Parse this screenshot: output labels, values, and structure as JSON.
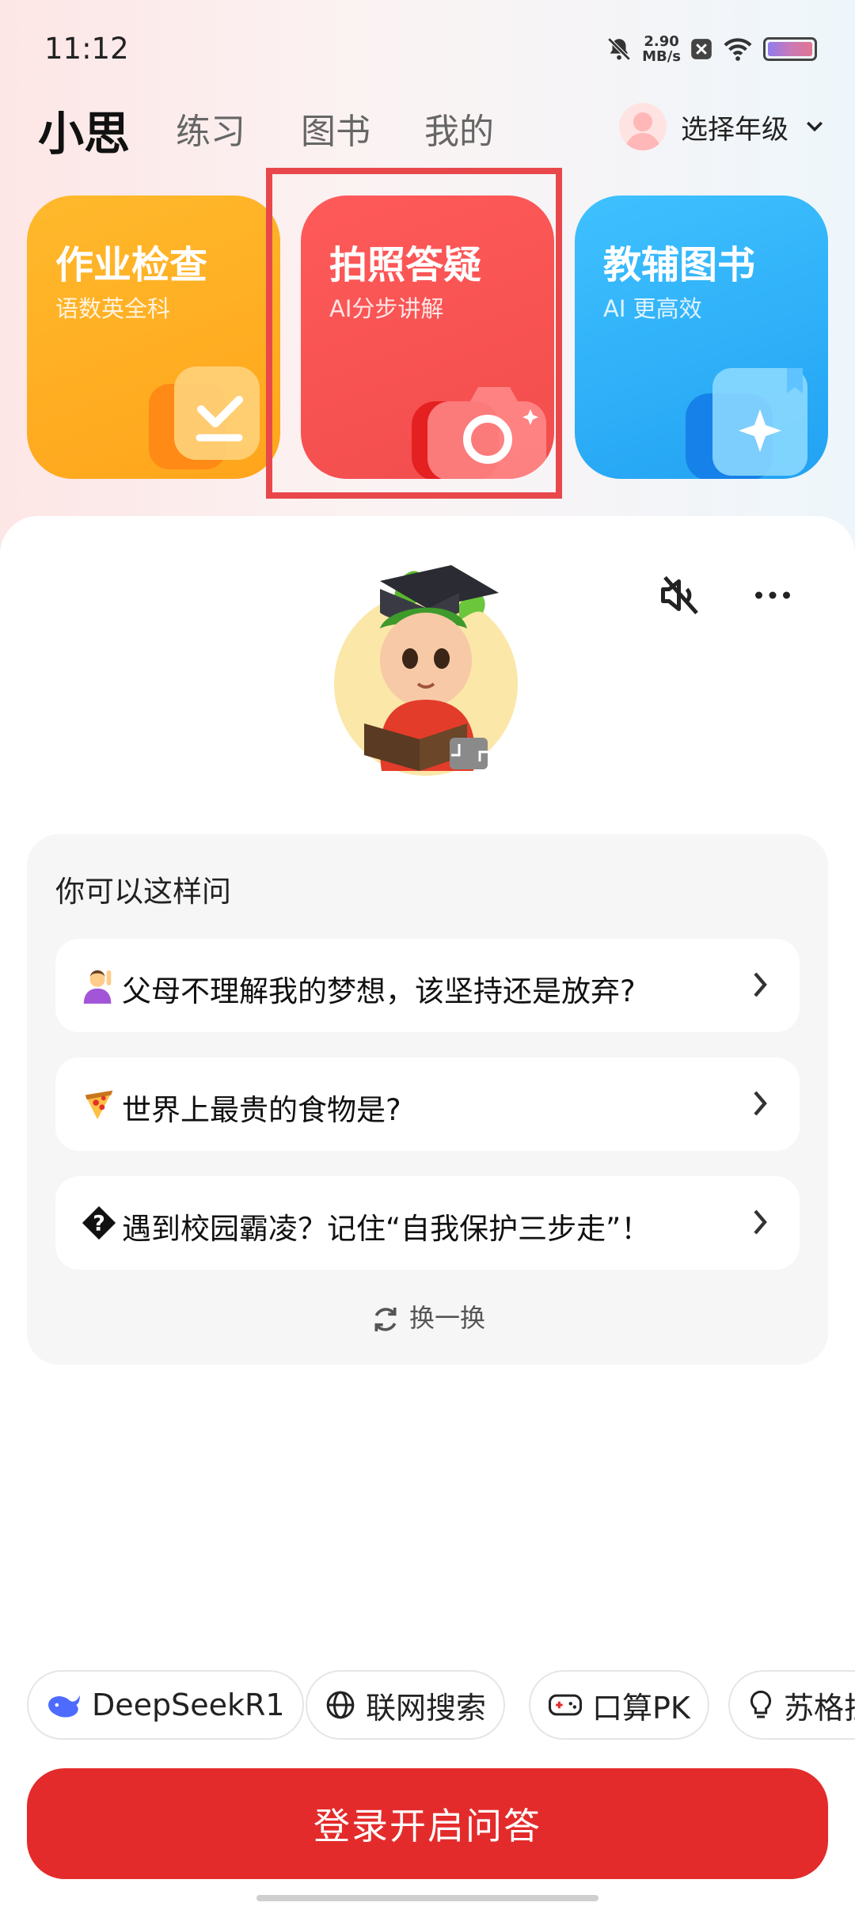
{
  "status_bar": {
    "time": "11:12",
    "speed_value": "2.90",
    "speed_unit": "MB/s"
  },
  "header": {
    "tabs": [
      {
        "label": "小思"
      },
      {
        "label": "练习"
      },
      {
        "label": "图书"
      },
      {
        "label": "我的"
      }
    ],
    "grade_label": "选择年级"
  },
  "cards": [
    {
      "title": "作业检查",
      "subtitle": "语数英全科",
      "color": "#ffb22a"
    },
    {
      "title": "拍照答疑",
      "subtitle": "AI分步讲解",
      "color": "#f65252"
    },
    {
      "title": "教辅图书",
      "subtitle": "AI 更高效",
      "color": "#2cb0f8"
    }
  ],
  "suggestions": {
    "title": "你可以这样问",
    "items": [
      {
        "icon": "person-raising-hand-emoji",
        "text": "父母不理解我的梦想，该坚持还是放弃?"
      },
      {
        "icon": "pizza-emoji",
        "text": "世界上最贵的食物是?"
      },
      {
        "icon": "unknown-glyph-icon",
        "text": "遇到校园霸凌？记住“自我保护三步走”！"
      }
    ],
    "refresh_label": "换一换"
  },
  "chips": [
    {
      "icon": "deepseek-whale-icon",
      "label": "DeepSeekR1"
    },
    {
      "icon": "globe-icon",
      "label": "联网搜索"
    },
    {
      "icon": "gamepad-icon",
      "label": "口算PK"
    },
    {
      "icon": "lightbulb-icon",
      "label": "苏格拉底"
    }
  ],
  "login_button": "登录开启问答",
  "colors": {
    "accent": "#e42b2b",
    "highlight_frame": "#e8484b"
  }
}
